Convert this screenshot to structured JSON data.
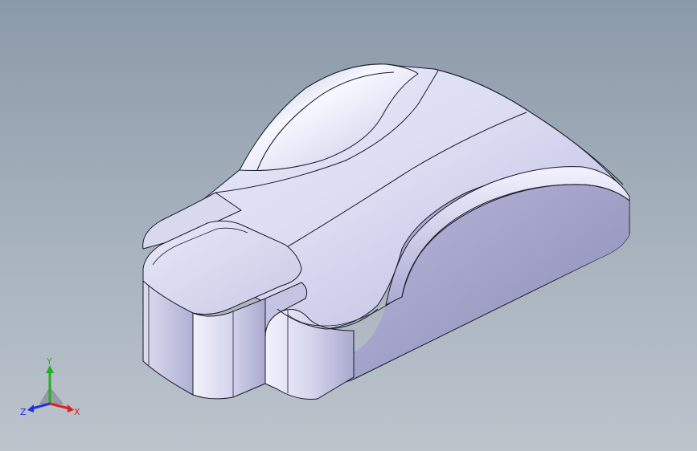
{
  "viewport": {
    "background_top": "#8b9aa9",
    "background_bottom": "#bcc4cc"
  },
  "model": {
    "face_color": "#c8c8e8",
    "highlight_color": "#f4f4ff",
    "shadow_color": "#8f8fb8",
    "edge_color": "#1a1a2a"
  },
  "triad": {
    "x_label": "X",
    "y_label": "Y",
    "z_label": "Z",
    "x_color": "#e02020",
    "y_color": "#20b020",
    "z_color": "#2030e0"
  }
}
